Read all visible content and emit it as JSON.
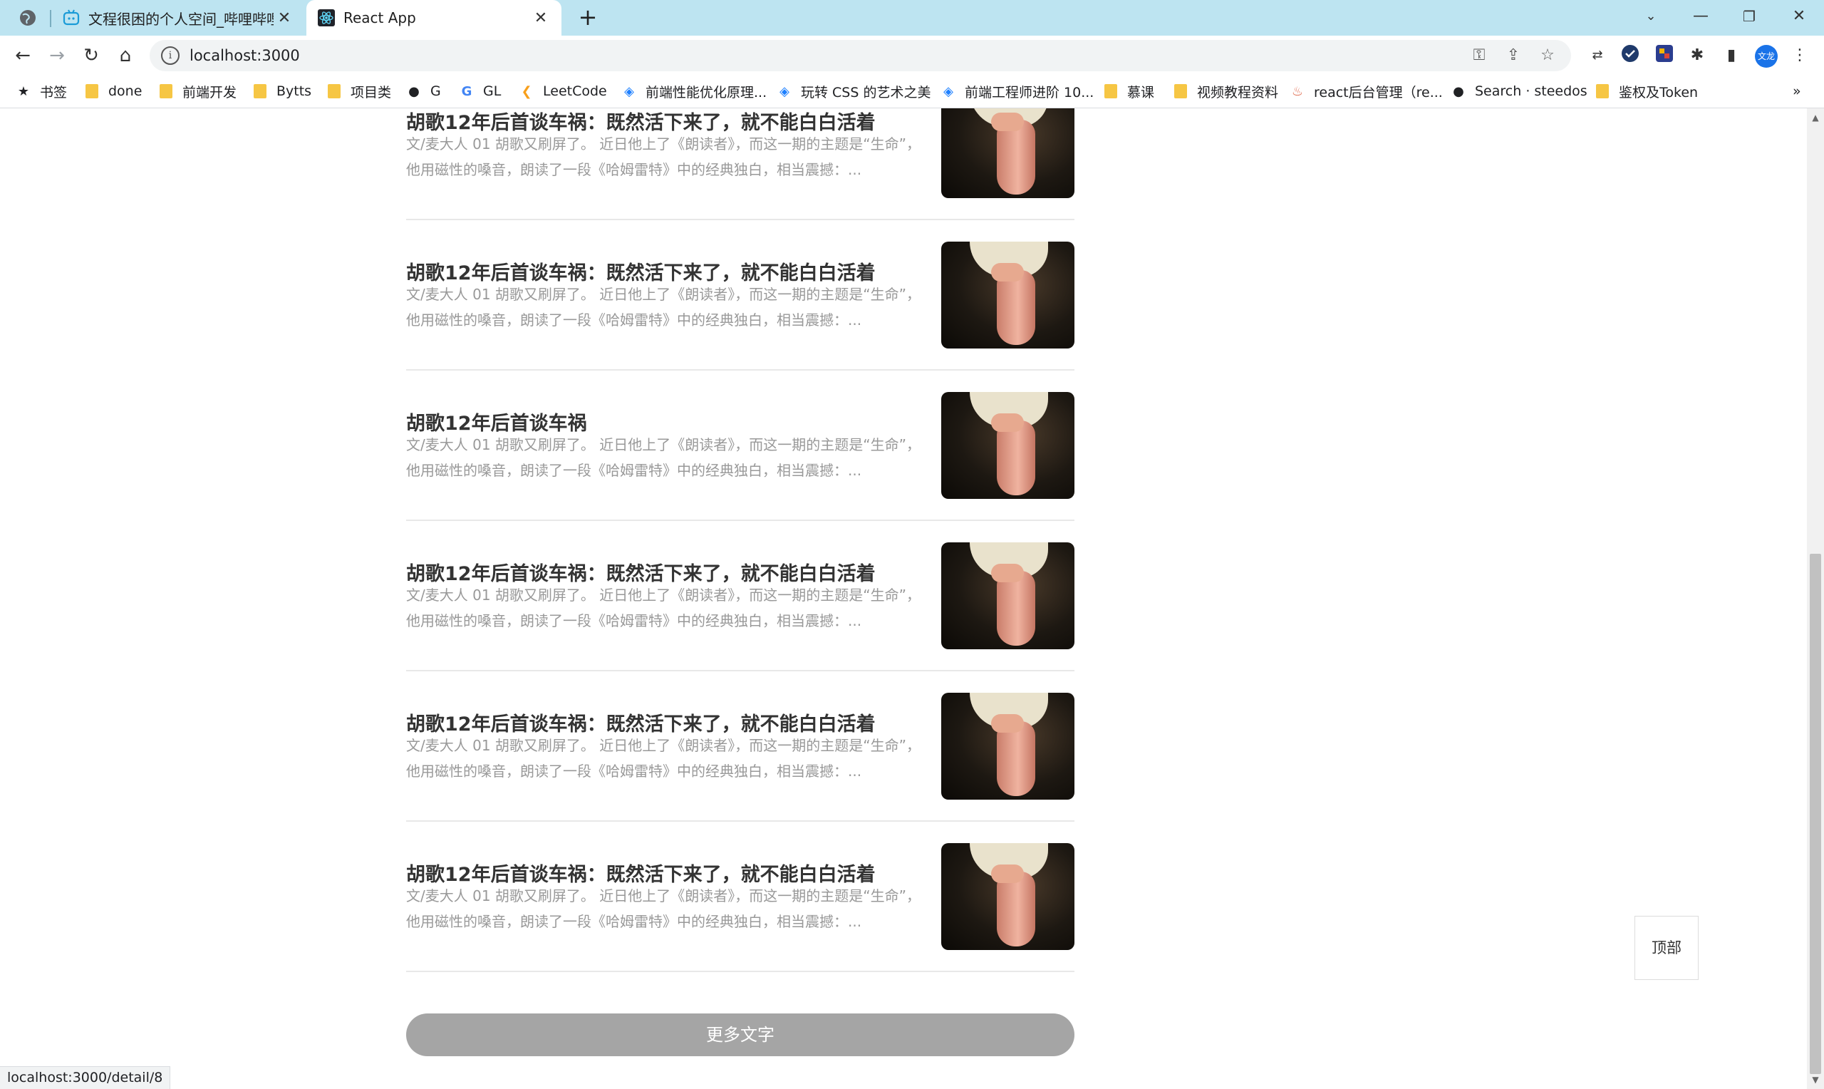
{
  "browser": {
    "tabs": [
      {
        "title": "文程很困的个人空间_哔哩哔哩_b",
        "close": "✕",
        "icon": "bilibili-icon"
      },
      {
        "title": "React App",
        "close": "✕",
        "icon": "react-icon"
      }
    ],
    "new_tab": "+",
    "address": "localhost:3000",
    "avatar_text": "文龙",
    "status_url": "localhost:3000/detail/8",
    "window_controls": {
      "minimize": "—",
      "maximize": "❐",
      "close": "✕"
    },
    "bookmarks": [
      {
        "label": "书签",
        "icon": "star-icon"
      },
      {
        "label": "done",
        "icon": "folder-icon"
      },
      {
        "label": "前端开发",
        "icon": "folder-icon"
      },
      {
        "label": "Bytts",
        "icon": "folder-icon"
      },
      {
        "label": "项目类",
        "icon": "folder-icon"
      },
      {
        "label": "G",
        "icon": "github-icon"
      },
      {
        "label": "GL",
        "icon": "google-icon"
      },
      {
        "label": "LeetCode",
        "icon": "leetcode-icon"
      },
      {
        "label": "前端性能优化原理...",
        "icon": "juejin-icon"
      },
      {
        "label": "玩转 CSS 的艺术之美",
        "icon": "juejin-icon"
      },
      {
        "label": "前端工程师进阶 10...",
        "icon": "juejin-icon"
      },
      {
        "label": "慕课",
        "icon": "folder-icon"
      },
      {
        "label": "视频教程资料",
        "icon": "folder-icon"
      },
      {
        "label": "react后台管理（re...",
        "icon": "site-icon"
      },
      {
        "label": "Search · steedos",
        "icon": "github-icon"
      },
      {
        "label": "鉴权及Token",
        "icon": "folder-icon"
      }
    ],
    "bookmarks_overflow": "»"
  },
  "articles": [
    {
      "title": "胡歌12年后首谈车祸：既然活下来了，就不能白白活着",
      "desc": "文/麦大人 01 胡歌又刷屏了。 近日他上了《朗读者》，而这一期的主题是“生命”，他用磁性的嗓音，朗读了一段《哈姆雷特》中的经典独白，相当震撼：..."
    },
    {
      "title": "胡歌12年后首谈车祸：既然活下来了，就不能白白活着",
      "desc": "文/麦大人 01 胡歌又刷屏了。 近日他上了《朗读者》，而这一期的主题是“生命”，他用磁性的嗓音，朗读了一段《哈姆雷特》中的经典独白，相当震撼：..."
    },
    {
      "title": "胡歌12年后首谈车祸",
      "desc": "文/麦大人 01 胡歌又刷屏了。 近日他上了《朗读者》，而这一期的主题是“生命”，他用磁性的嗓音，朗读了一段《哈姆雷特》中的经典独白，相当震撼：..."
    },
    {
      "title": "胡歌12年后首谈车祸：既然活下来了，就不能白白活着",
      "desc": "文/麦大人 01 胡歌又刷屏了。 近日他上了《朗读者》，而这一期的主题是“生命”，他用磁性的嗓音，朗读了一段《哈姆雷特》中的经典独白，相当震撼：..."
    },
    {
      "title": "胡歌12年后首谈车祸：既然活下来了，就不能白白活着",
      "desc": "文/麦大人 01 胡歌又刷屏了。 近日他上了《朗读者》，而这一期的主题是“生命”，他用磁性的嗓音，朗读了一段《哈姆雷特》中的经典独白，相当震撼：..."
    },
    {
      "title": "胡歌12年后首谈车祸：既然活下来了，就不能白白活着",
      "desc": "文/麦大人 01 胡歌又刷屏了。 近日他上了《朗读者》，而这一期的主题是“生命”，他用磁性的嗓音，朗读了一段《哈姆雷特》中的经典独白，相当震撼：..."
    }
  ],
  "more_button": "更多文字",
  "back_top": "顶部",
  "colors": {
    "tab_strip": "#bde4f1",
    "more_button": "#a5a5a5",
    "desc_text": "#999999"
  }
}
